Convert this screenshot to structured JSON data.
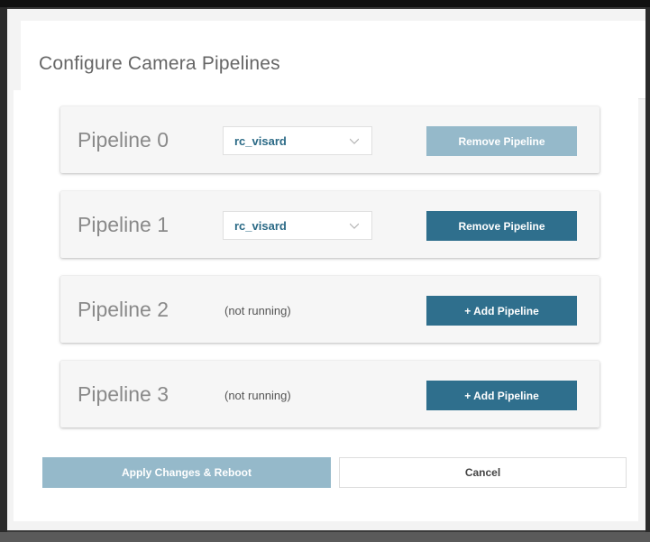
{
  "dialog": {
    "title": "Configure Camera Pipelines"
  },
  "pipelines": [
    {
      "label": "Pipeline 0",
      "selected": "rc_visard",
      "button": "Remove Pipeline",
      "button_state": "disabled"
    },
    {
      "label": "Pipeline 1",
      "selected": "rc_visard",
      "button": "Remove Pipeline",
      "button_state": "enabled"
    },
    {
      "label": "Pipeline 2",
      "status": "(not running)",
      "button": "+ Add Pipeline",
      "button_state": "enabled"
    },
    {
      "label": "Pipeline 3",
      "status": "(not running)",
      "button": "+ Add Pipeline",
      "button_state": "enabled"
    }
  ],
  "footer": {
    "apply_label": "Apply Changes & Reboot",
    "apply_state": "disabled",
    "cancel_label": "Cancel"
  },
  "colors": {
    "primary": "#2f6f8d",
    "disabled": "#95b9ca",
    "select_text": "#2b6a86"
  },
  "icons": {
    "select_chevron": "chevron-down-icon"
  }
}
